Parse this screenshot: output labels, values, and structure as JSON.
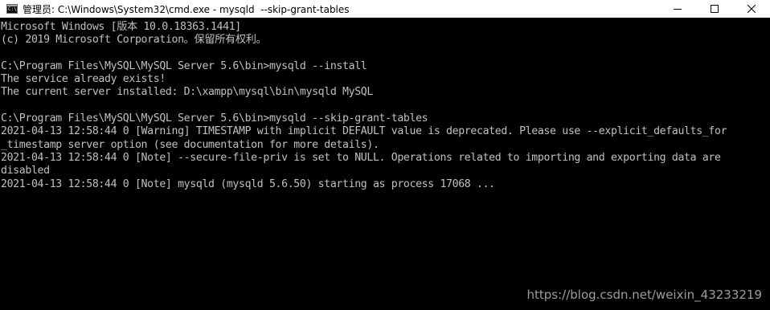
{
  "window": {
    "title": "管理员: C:\\Windows\\System32\\cmd.exe - mysqld  --skip-grant-tables",
    "icon": "cmd-icon",
    "controls": [
      "minimize-icon",
      "maximize-icon",
      "close-icon"
    ]
  },
  "console": {
    "text_color": "#c0c0c0",
    "background_color": "#000000",
    "lines": [
      "Microsoft Windows [版本 10.0.18363.1441]",
      "(c) 2019 Microsoft Corporation。保留所有权利。",
      "",
      "C:\\Program Files\\MySQL\\MySQL Server 5.6\\bin>mysqld --install",
      "The service already exists!",
      "The current server installed: D:\\xampp\\mysql\\bin\\mysqld MySQL",
      "",
      "C:\\Program Files\\MySQL\\MySQL Server 5.6\\bin>mysqld --skip-grant-tables",
      "2021-04-13 12:58:44 0 [Warning] TIMESTAMP with implicit DEFAULT value is deprecated. Please use --explicit_defaults_for",
      "_timestamp server option (see documentation for more details).",
      "2021-04-13 12:58:44 0 [Note] --secure-file-priv is set to NULL. Operations related to importing and exporting data are",
      "disabled",
      "2021-04-13 12:58:44 0 [Note] mysqld (mysqld 5.6.50) starting as process 17068 ..."
    ]
  },
  "watermark": {
    "text": "https://blog.csdn.net/weixin_43233219"
  }
}
